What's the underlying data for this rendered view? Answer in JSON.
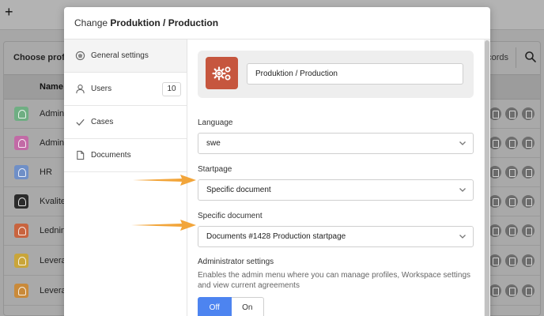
{
  "background": {
    "plus_icon": "+",
    "choose_label": "Choose profil",
    "records_label": "ecords",
    "name_header": "Name",
    "rows": [
      {
        "name": "Admin",
        "color": "#6fae83"
      },
      {
        "name": "Admin",
        "color": "#c26aa6"
      },
      {
        "name": "HR",
        "color": "#6f8fc7"
      },
      {
        "name": "Kvalitet",
        "color": "#2b2b2b"
      },
      {
        "name": "Ledning",
        "color": "#c8643f"
      },
      {
        "name": "Leveran",
        "color": "#c9a53a"
      },
      {
        "name": "Leveran",
        "color": "#c98a3a"
      }
    ]
  },
  "modal": {
    "title_prefix": "Change",
    "title_name": "Produktion / Production",
    "sidebar": {
      "items": [
        {
          "label": "General settings",
          "icon": "gear-icon",
          "active": true
        },
        {
          "label": "Users",
          "icon": "user-icon",
          "badge": "10"
        },
        {
          "label": "Cases",
          "icon": "check-icon"
        },
        {
          "label": "Documents",
          "icon": "document-icon"
        }
      ]
    },
    "profile_name_value": "Produktion / Production",
    "language": {
      "label": "Language",
      "value": "swe"
    },
    "startpage": {
      "label": "Startpage",
      "value": "Specific document"
    },
    "specific_document": {
      "label": "Specific document",
      "value": "Documents #1428 Production startpage"
    },
    "admin_settings": {
      "label": "Administrator settings",
      "description": "Enables the admin menu where you can manage profiles, Workspace settings and view current agreements",
      "off_label": "Off",
      "on_label": "On",
      "selected": "Off"
    }
  },
  "colors": {
    "accent_blue": "#4d84f0",
    "logo_red": "#c6563e",
    "arrow_orange": "#f2a53a"
  }
}
